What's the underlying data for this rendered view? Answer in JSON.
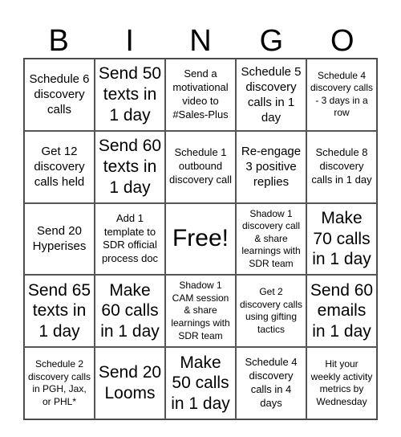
{
  "header": {
    "letters": [
      "B",
      "I",
      "N",
      "G",
      "O"
    ]
  },
  "cells": [
    [
      "Schedule 6 discovery calls",
      "Send 50 texts in 1 day",
      "Send a motivational video to #Sales-Plus",
      "Schedule 5 discovery calls in 1 day",
      "Schedule 4 discovery calls - 3 days in a row"
    ],
    [
      "Get 12 discovery calls held",
      "Send 60 texts in 1 day",
      "Schedule 1 outbound discovery call",
      "Re-engage 3 positive replies",
      "Schedule 8 discovery calls in 1 day"
    ],
    [
      "Send 20 Hyperises",
      "Add 1 template to SDR official process doc",
      "Free!",
      "Shadow 1 discovery call & share learnings with SDR team",
      "Make 70 calls in 1 day"
    ],
    [
      "Send 65 texts in 1 day",
      "Make 60 calls in 1 day",
      "Shadow 1 CAM session & share learnings with SDR team",
      "Get 2 discovery calls using gifting tactics",
      "Send 60 emails in 1 day"
    ],
    [
      "Schedule 2 discovery calls in PGH, Jax, or PHL*",
      "Send 20 Looms",
      "Make 50 calls in 1 day",
      "Schedule 4 discovery calls in 4 days",
      "Hit your weekly activity metrics by Wednesday"
    ]
  ]
}
